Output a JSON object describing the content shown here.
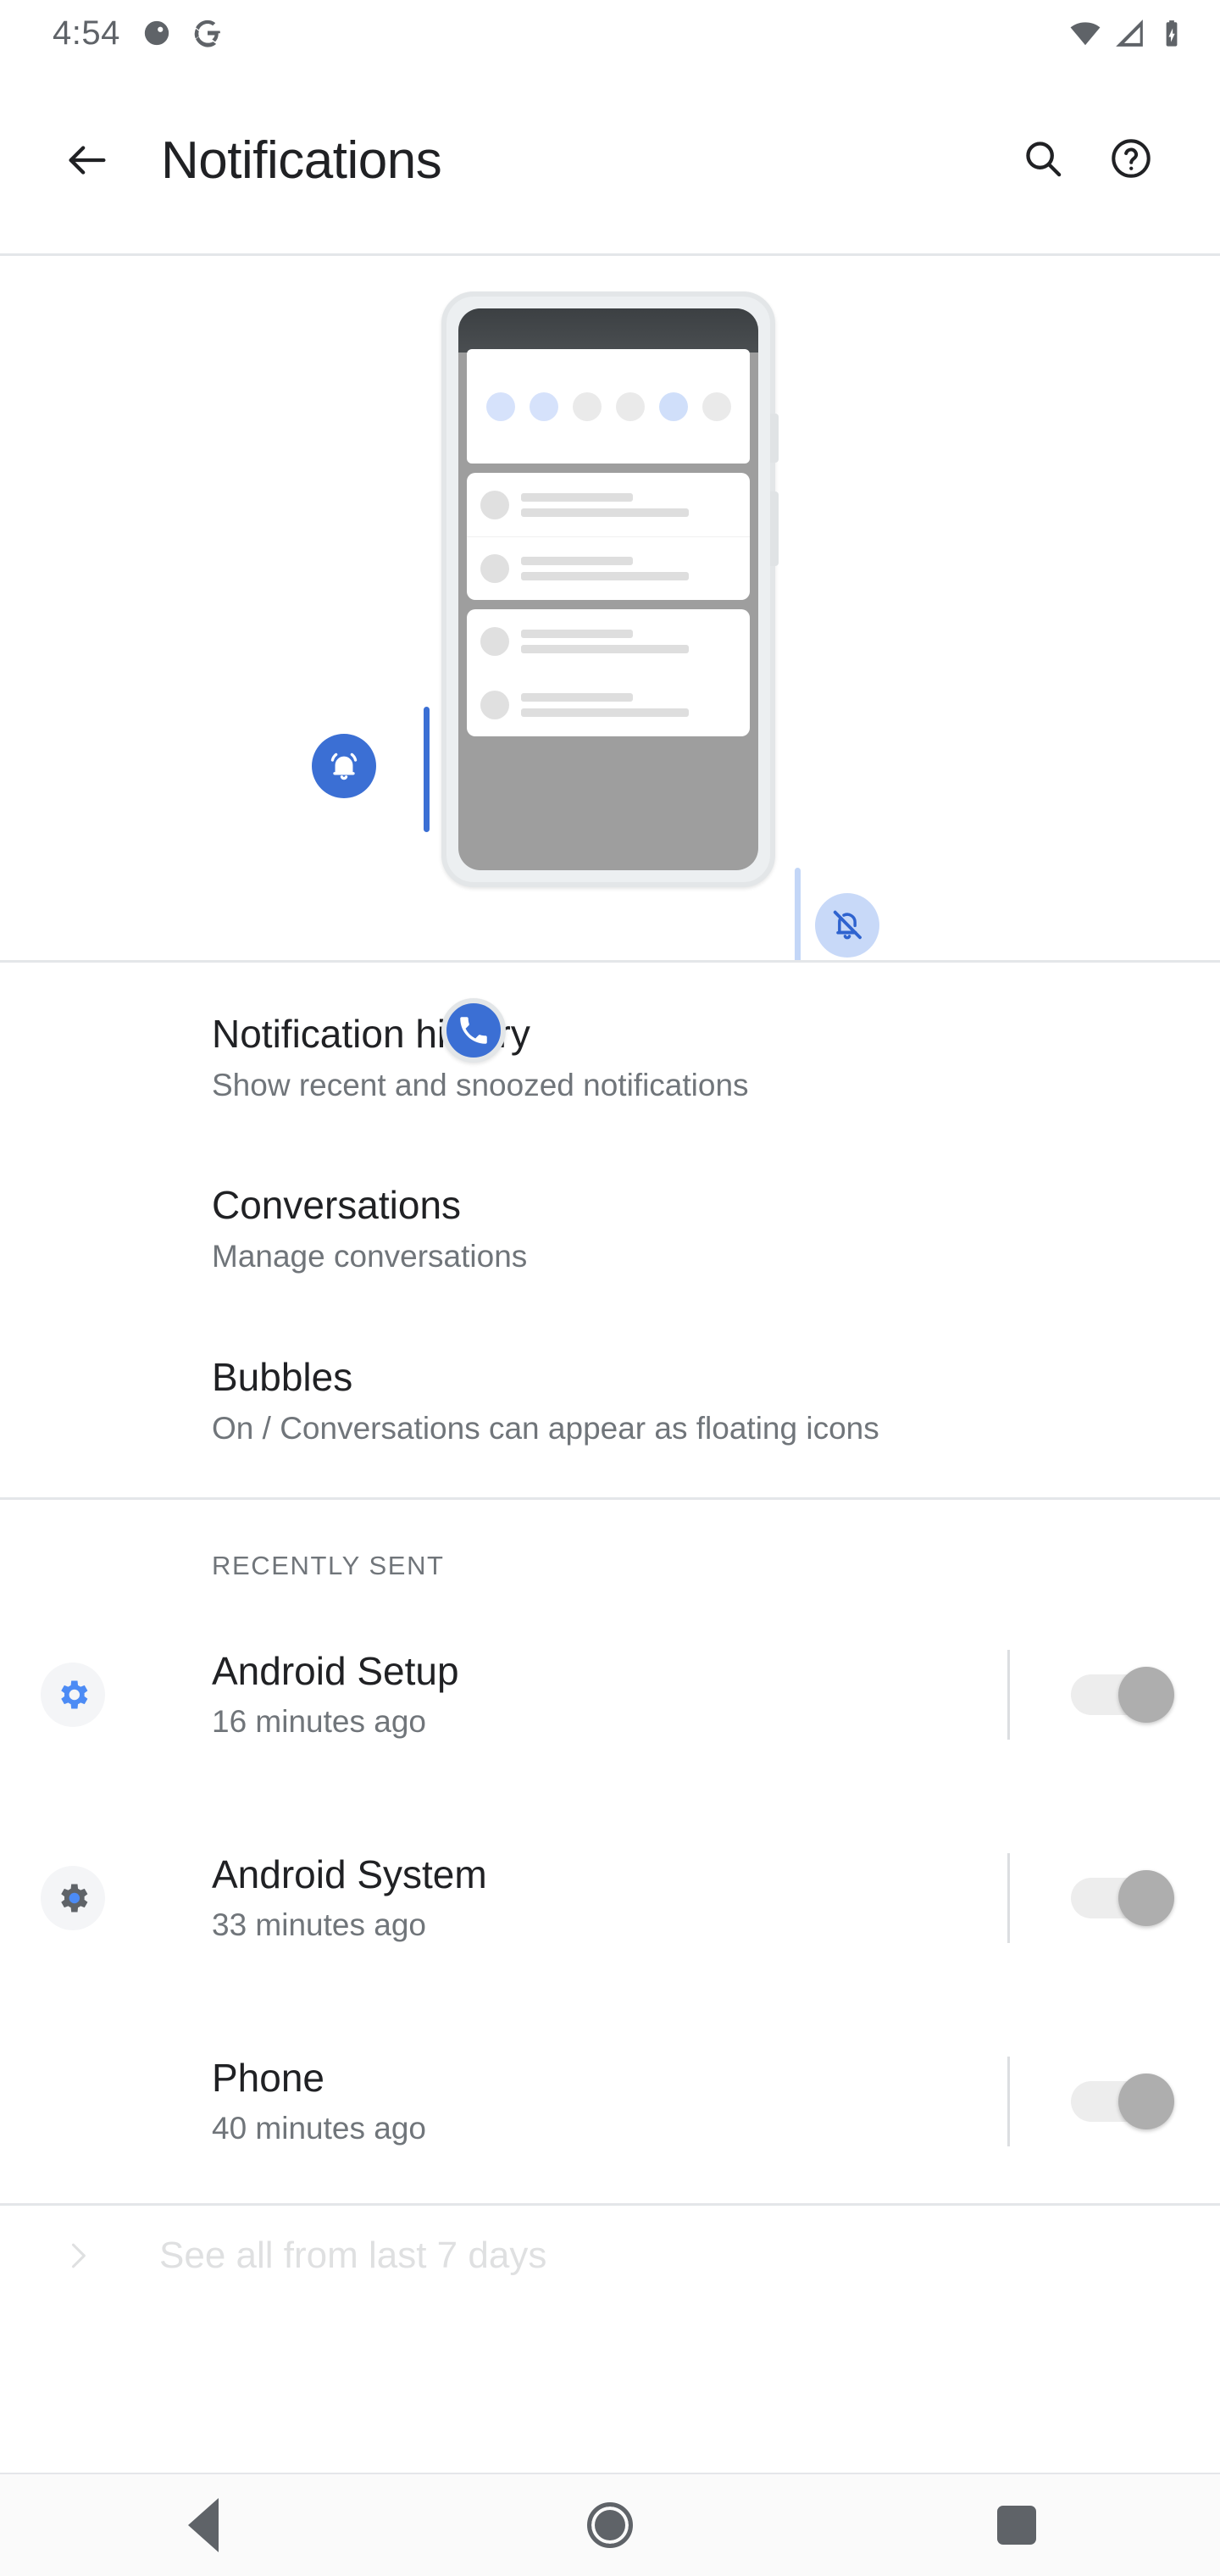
{
  "statusbar": {
    "clock": "4:54",
    "icons": [
      "dnd-icon",
      "google-icon",
      "wifi-icon",
      "cellular-signal-icon",
      "battery-charging-icon"
    ]
  },
  "appbar": {
    "back_label": "back-arrow",
    "title": "Notifications",
    "search_label": "search-icon",
    "help_label": "help-icon"
  },
  "illustration": {
    "name": "notifications-illustration",
    "bell_on_label": "bell-ringing-icon",
    "bell_off_label": "bell-off-icon",
    "qs_dots": [
      "#d6e2fb",
      "#d6e2fb",
      "#eaeaea",
      "#eaeaea",
      "#d0dffa",
      "#eaeaea"
    ]
  },
  "preferences": [
    {
      "title": "Notification history",
      "subtitle": "Show recent and snoozed notifications"
    },
    {
      "title": "Conversations",
      "subtitle": "Manage conversations"
    },
    {
      "title": "Bubbles",
      "subtitle": "On / Conversations can appear as floating icons"
    }
  ],
  "recently_sent": {
    "header": "RECENTLY SENT",
    "apps": [
      {
        "name": "Android Setup",
        "time": "16 minutes ago",
        "icon": "settings-gear-icon",
        "toggle_on": true
      },
      {
        "name": "Android System",
        "time": "33 minutes ago",
        "icon": "settings-gear-icon",
        "toggle_on": true
      },
      {
        "name": "Phone",
        "time": "40 minutes ago",
        "icon": "phone-handset-icon",
        "toggle_on": true
      }
    ],
    "see_all": "See all from last 7 days"
  },
  "navbar": {
    "back": "back-nav-button",
    "home": "home-nav-button",
    "recents": "recents-nav-button"
  },
  "colors": {
    "accent_blue": "#3b6fd4",
    "light_blue": "#c8d9f8",
    "title_text": "#202124",
    "secondary_text": "#70757a"
  }
}
